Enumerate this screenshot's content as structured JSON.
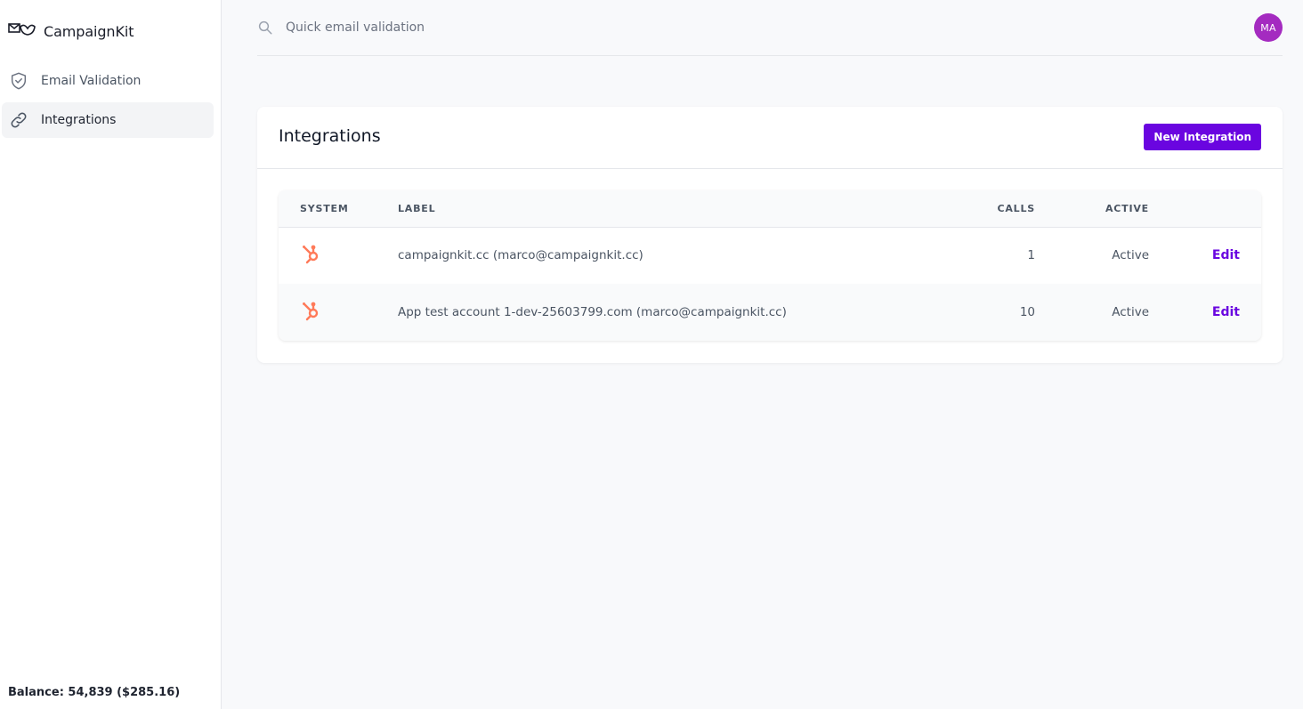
{
  "app": {
    "brand_name": "CampaignKit",
    "logo_icon": "envelope-bird-logo-icon"
  },
  "sidebar": {
    "items": [
      {
        "label": "Email Validation",
        "icon": "shield-check-icon",
        "active": false
      },
      {
        "label": "Integrations",
        "icon": "link-icon",
        "active": true
      }
    ],
    "balance": "Balance: 54,839 ($285.16)"
  },
  "topbar": {
    "search_placeholder": "Quick email validation",
    "avatar_initials": "MA",
    "avatar_color": "#a42bc0"
  },
  "integrations": {
    "title": "Integrations",
    "new_button": "New Integration",
    "columns": {
      "system": "SYSTEM",
      "label": "LABEL",
      "calls": "CALLS",
      "active": "ACTIVE"
    },
    "rows": [
      {
        "system_icon": "hubspot-icon",
        "label": "campaignkit.cc (marco@campaignkit.cc)",
        "calls": "1",
        "status": "Active",
        "action": "Edit"
      },
      {
        "system_icon": "hubspot-icon",
        "label": "App test account 1-dev-25603799.com (marco@campaignkit.cc)",
        "calls": "10",
        "status": "Active",
        "action": "Edit"
      }
    ]
  },
  "colors": {
    "accent": "#6a05e0",
    "hubspot": "#ff7a59"
  }
}
